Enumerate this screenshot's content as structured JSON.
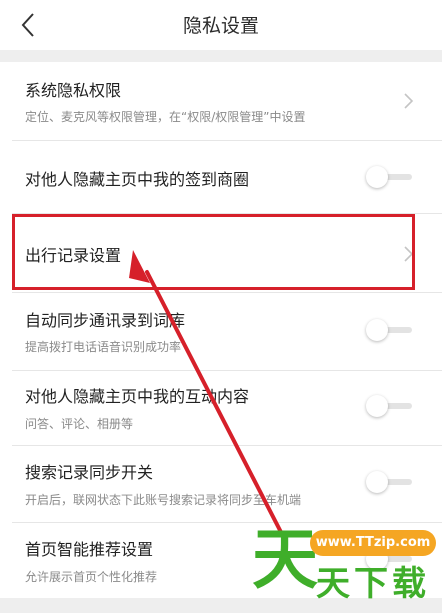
{
  "header": {
    "title": "隐私设置",
    "back_icon": "chevron-left-icon"
  },
  "settings": [
    {
      "label": "系统隐私权限",
      "subtitle": "定位、麦克风等权限管理，在“权限/权限管理”中设置",
      "control": "chevron"
    },
    {
      "label": "对他人隐藏主页中我的签到商圈",
      "subtitle": "",
      "control": "toggle",
      "toggle_on": false
    },
    {
      "label": "出行记录设置",
      "subtitle": "",
      "control": "chevron",
      "highlighted": true
    },
    {
      "label": "自动同步通讯录到词库",
      "subtitle": "提高拨打电话语音识别成功率",
      "control": "toggle",
      "toggle_on": false
    },
    {
      "label": "对他人隐藏主页中我的互动内容",
      "subtitle": "问答、评论、相册等",
      "control": "toggle",
      "toggle_on": false
    },
    {
      "label": "搜索记录同步开关",
      "subtitle": "开启后，联网状态下此账号搜索记录将同步至车机端",
      "control": "toggle",
      "toggle_on": false
    },
    {
      "label": "首页智能推荐设置",
      "subtitle": "允许展示首页个性化推荐",
      "control": "toggle",
      "toggle_on": false
    }
  ],
  "annotation": {
    "box_color": "#d6202a",
    "arrow_color": "#d6202a"
  },
  "watermark": {
    "url": "www.TTzip.com",
    "big_char": "天",
    "small_text": "天下载",
    "color": "#3fae2a",
    "badge_color": "#f5a623"
  }
}
